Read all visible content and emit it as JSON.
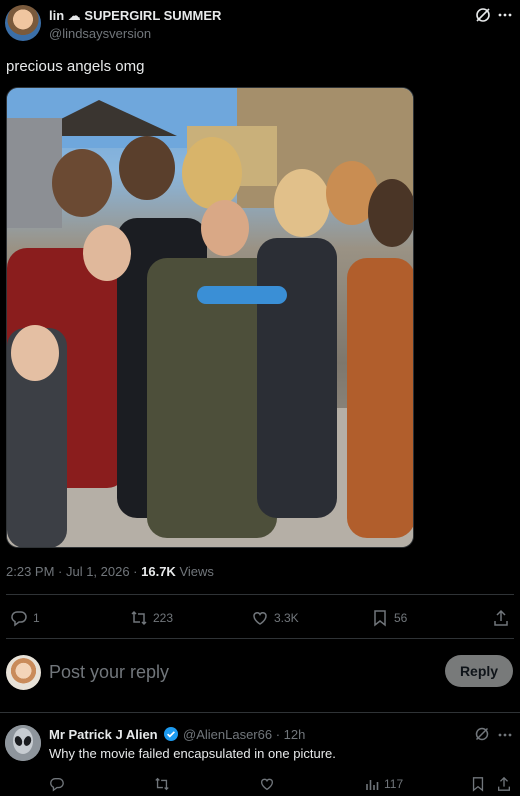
{
  "post": {
    "author_name": "lin",
    "author_name_rest": "SUPERGIRL SUMMER",
    "handle": "@lindsaysversion",
    "text": "precious angels omg",
    "timestamp": "2:23 PM · Jul 1, 2026 · ",
    "views_count": "16.7K",
    "views_label": " Views"
  },
  "stats": {
    "replies": "1",
    "reposts": "223",
    "likes": "3.3K",
    "bookmarks": "56"
  },
  "reply_box": {
    "placeholder": "Post your reply",
    "button_label": "Reply"
  },
  "comment": {
    "author": "Mr Patrick J Alien",
    "handle": "@AlienLaser66 · 12h",
    "text": "Why the movie failed encapsulated in one picture.",
    "views": "117"
  },
  "icons": {
    "cloud": "cloud-emoji",
    "grok": "grok-icon",
    "more": "more-icon",
    "reply": "reply-icon",
    "repost": "repost-icon",
    "like": "heart-icon",
    "bookmark": "bookmark-icon",
    "share": "share-icon",
    "views": "analytics-icon",
    "verified": "verified-badge-icon"
  },
  "colors": {
    "background": "#000000",
    "text_primary": "#e7e9ea",
    "text_secondary": "#71767b",
    "divider": "#2f3336",
    "verified": "#1d9bf0",
    "reply_button": "#787a7a"
  }
}
